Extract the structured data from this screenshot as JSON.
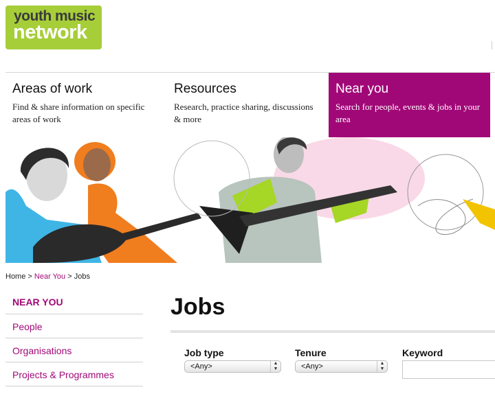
{
  "logo": {
    "line1": "youth music",
    "line2": "network"
  },
  "nav": {
    "areas": {
      "title": "Areas of work",
      "desc": "Find & share information on specific areas of work"
    },
    "resources": {
      "title": "Resources",
      "desc": "Research, practice sharing, discussions & more"
    },
    "near": {
      "title": "Near you",
      "desc": "Search for people, events & jobs in your area"
    }
  },
  "breadcrumb": {
    "home": "Home",
    "sep1": ">",
    "near": "Near You",
    "sep2": ">",
    "current": "Jobs"
  },
  "sidebar": {
    "heading": "NEAR YOU",
    "items": [
      {
        "label": "People"
      },
      {
        "label": "Organisations"
      },
      {
        "label": "Projects & Programmes"
      }
    ]
  },
  "page": {
    "title": "Jobs"
  },
  "filters": {
    "job_type": {
      "label": "Job type",
      "value": "<Any>"
    },
    "tenure": {
      "label": "Tenure",
      "value": "<Any>"
    },
    "keyword": {
      "label": "Keyword",
      "value": ""
    }
  },
  "colors": {
    "brand_green": "#a6ce39",
    "brand_magenta": "#a10877",
    "banner_cyan": "#3fb5e6",
    "banner_orange": "#f07d1e",
    "banner_lime": "#a6d626"
  }
}
